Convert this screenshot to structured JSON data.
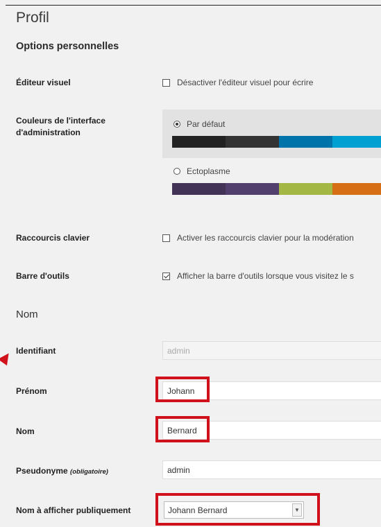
{
  "page_title": "Profil",
  "personal_options": {
    "title": "Options personnelles",
    "visual_editor": {
      "label": "Éditeur visuel",
      "option": "Désactiver l'éditeur visuel pour écrire",
      "checked": false
    },
    "admin_colors": {
      "label": "Couleurs de l'interface d'administration",
      "schemes": [
        {
          "name": "Par défaut",
          "selected": true,
          "colors": [
            "#222222",
            "#333333",
            "#0073aa",
            "#00a0d2"
          ]
        },
        {
          "name": "Ectoplasme",
          "selected": false,
          "colors": [
            "#413256",
            "#523f6d",
            "#a3b745",
            "#d46f15"
          ]
        }
      ]
    },
    "keyboard_shortcuts": {
      "label": "Raccourcis clavier",
      "option": "Activer les raccourcis clavier pour la modération",
      "checked": false
    },
    "toolbar": {
      "label": "Barre d'outils",
      "option": "Afficher la barre d'outils lorsque vous visitez le s",
      "checked": true
    }
  },
  "name_section": {
    "title": "Nom",
    "username": {
      "label": "Identifiant",
      "value": "admin"
    },
    "first_name": {
      "label": "Prénom",
      "value": "Johann"
    },
    "last_name": {
      "label": "Nom",
      "value": "Bernard"
    },
    "nickname": {
      "label": "Pseudonyme",
      "required_note": "(obligatoire)",
      "value": "admin"
    },
    "display_name": {
      "label": "Nom à afficher publiquement",
      "value": "Johann Bernard"
    }
  },
  "highlight_color": "#d0101b"
}
